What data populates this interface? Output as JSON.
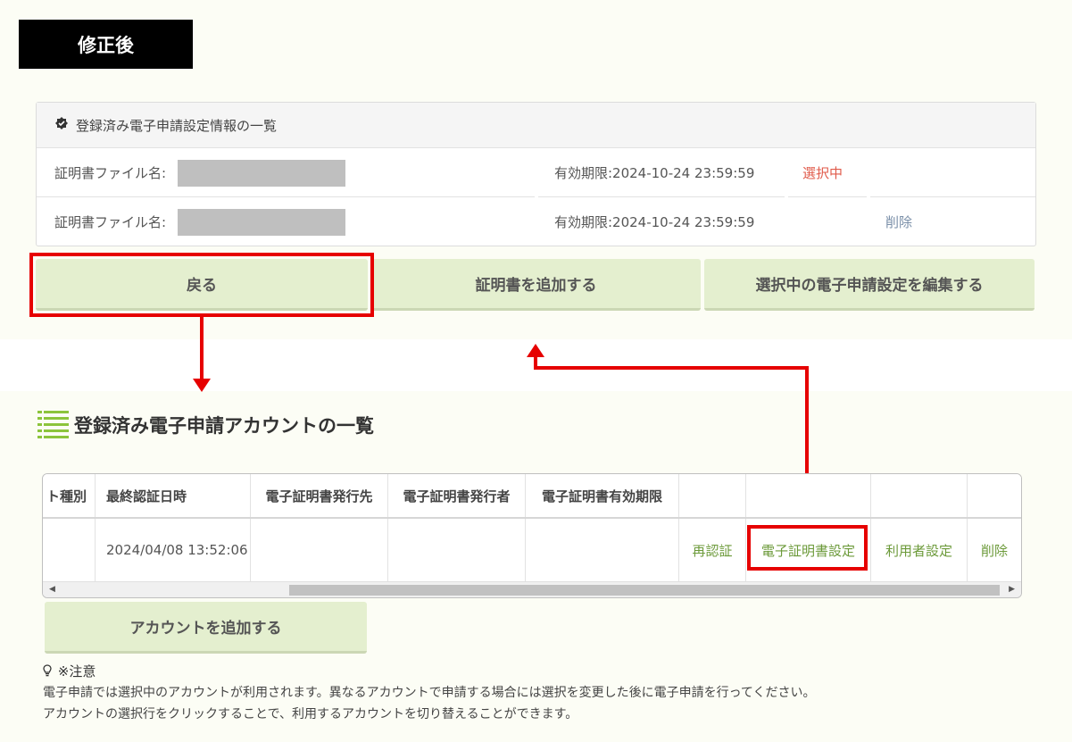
{
  "label": "修正後",
  "panel": {
    "title": "登録済み電子申請設定情報の一覧",
    "rows": [
      {
        "file_label": "証明書ファイル名:",
        "expiry": "有効期限:2024-10-24 23:59:59",
        "action": "選択中"
      },
      {
        "file_label": "証明書ファイル名:",
        "expiry": "有効期限:2024-10-24 23:59:59",
        "action": "削除"
      }
    ]
  },
  "buttons": {
    "back": "戻る",
    "add_cert": "証明書を追加する",
    "edit_selected": "選択中の電子申請設定を編集する",
    "add_account": "アカウントを追加する"
  },
  "accounts": {
    "title": "登録済み電子申請アカウントの一覧",
    "headers": [
      "ト種別",
      "最終認証日時",
      "電子証明書発行先",
      "電子証明書発行者",
      "電子証明書有効期限"
    ],
    "row": {
      "last_auth": "2024/04/08 13:52:06",
      "reauth": "再認証",
      "cert_setting": "電子証明書設定",
      "user_setting": "利用者設定",
      "delete": "削除"
    }
  },
  "note": {
    "title": "※注意",
    "line1": "電子申請では選択中のアカウントが利用されます。異なるアカウントで申請する場合には選択を変更した後に電子申請を行ってください。",
    "line2": "アカウントの選択行をクリックすることで、利用するアカウントを切り替えることができます。"
  }
}
